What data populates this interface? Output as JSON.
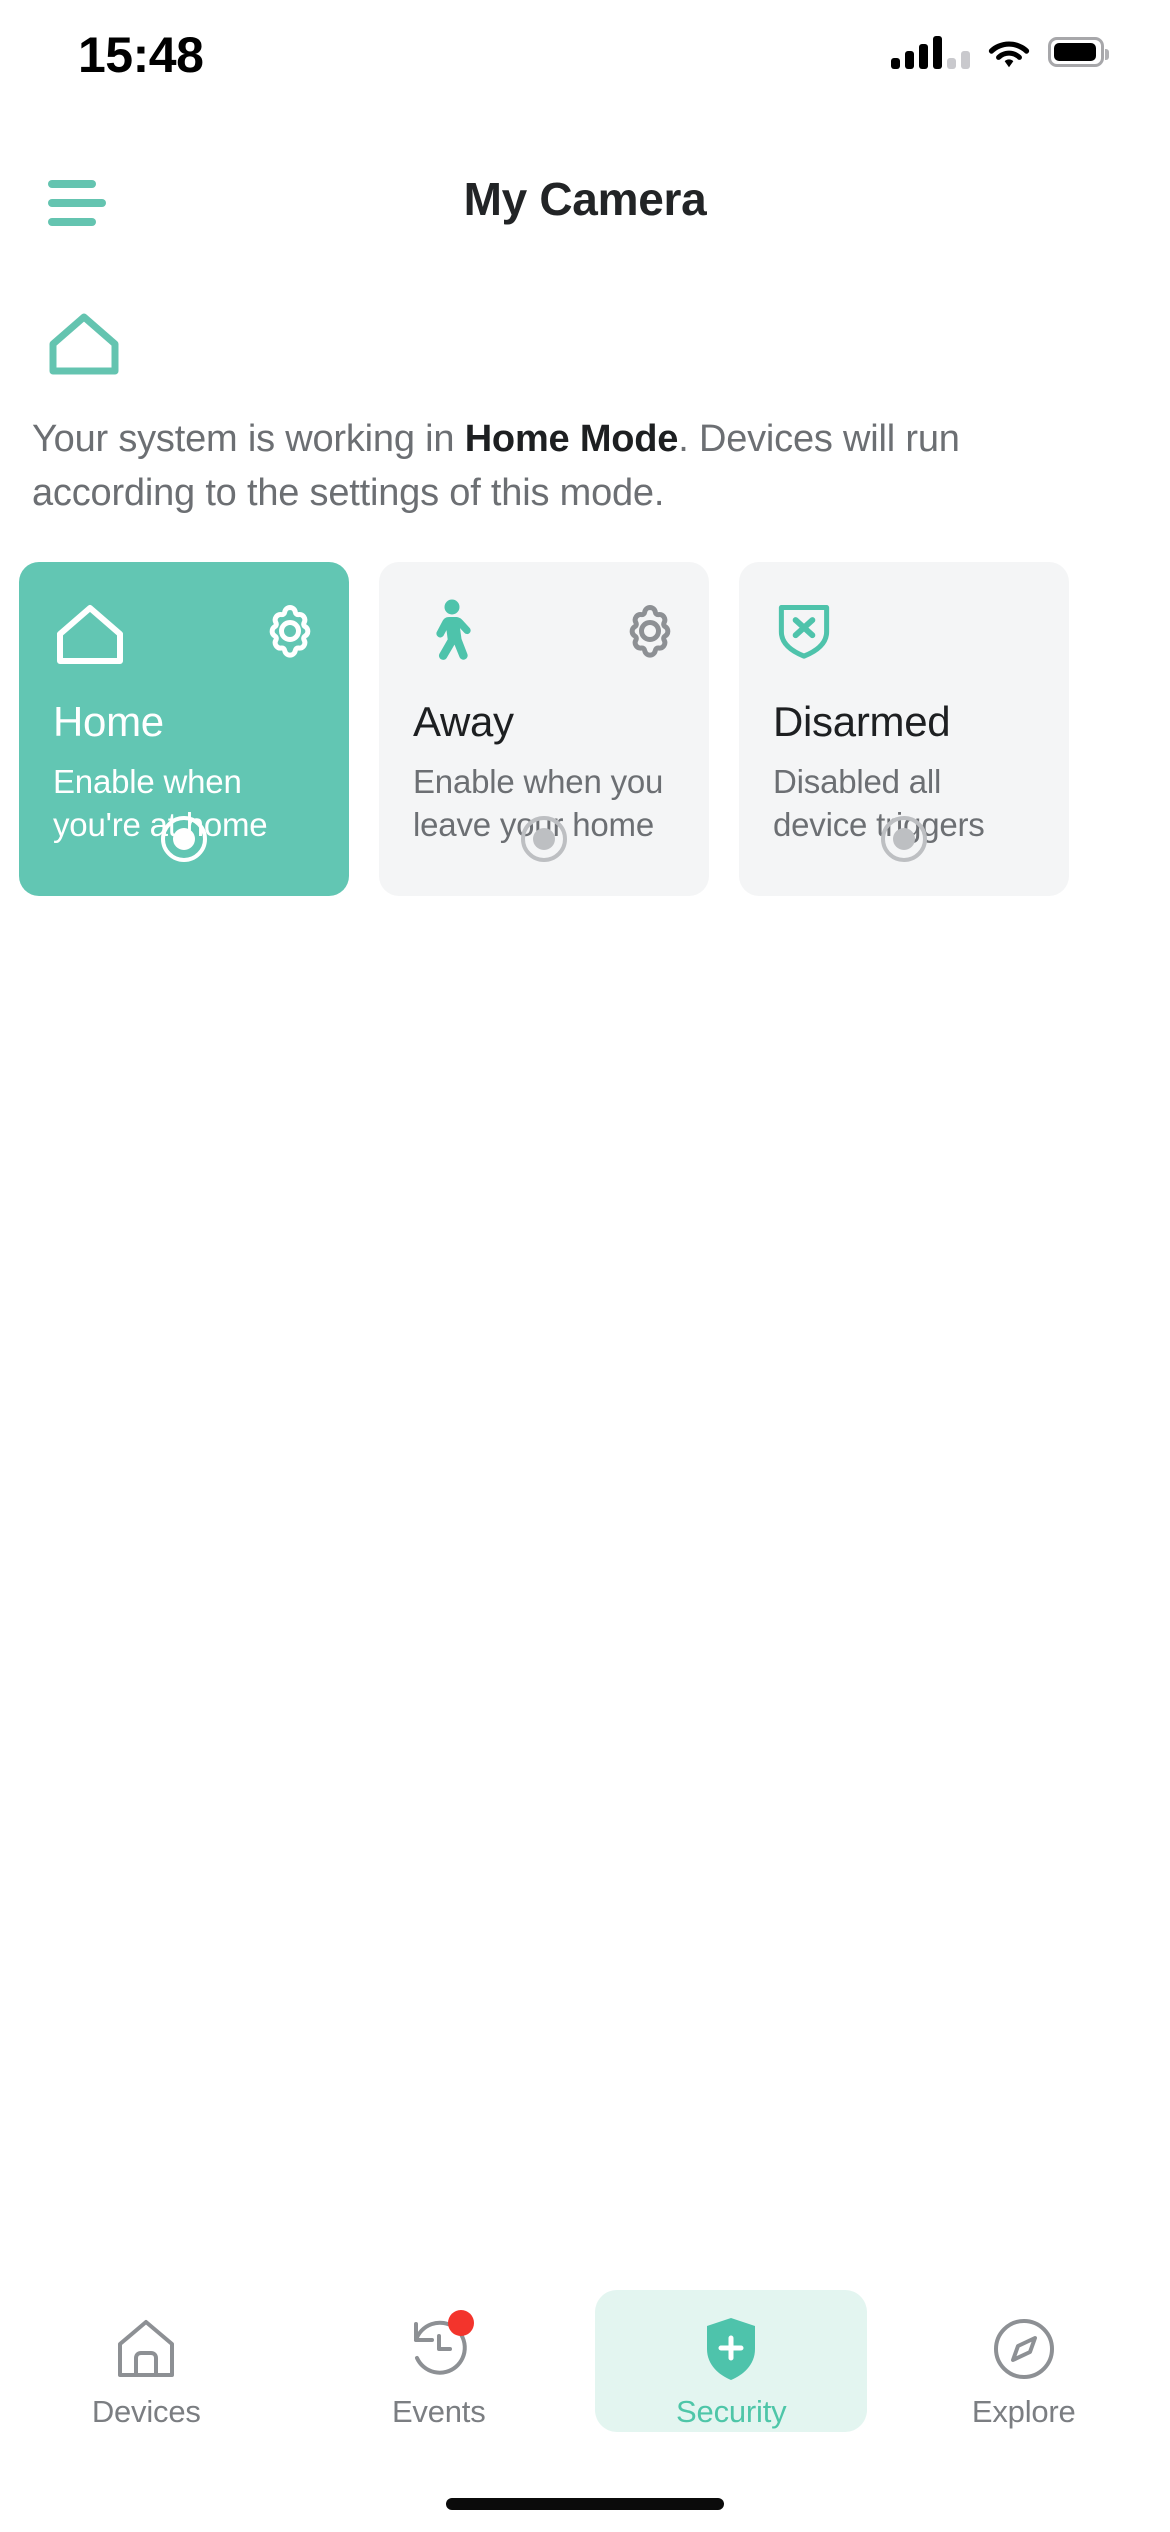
{
  "status_bar": {
    "time": "15:48",
    "signal_icon": "cellular-signal-icon",
    "wifi_icon": "wifi-icon",
    "battery_icon": "battery-icon"
  },
  "header": {
    "menu_icon": "hamburger-menu-icon",
    "title": "My Camera"
  },
  "mode_banner": {
    "icon": "home-outline-icon",
    "text_before": "Your system is working in ",
    "mode_name": "Home Mode",
    "text_after": ". Devices will run according to the settings of this mode."
  },
  "colors": {
    "accent": "#62c6b3",
    "accent_text": "#4ec6a8",
    "active_pill": "#e3f5f0",
    "card_bg": "#f4f5f6",
    "badge": "#f3342c",
    "title": "#222426",
    "muted_text": "#6c6f73"
  },
  "mode_cards": [
    {
      "id": "home",
      "icon": "home-outline-icon",
      "settings_icon": "gear-icon",
      "title": "Home",
      "subtitle": "Enable when you're at home",
      "selected": true,
      "has_settings": true
    },
    {
      "id": "away",
      "icon": "walking-person-icon",
      "settings_icon": "gear-icon",
      "title": "Away",
      "subtitle": "Enable when you leave your home",
      "selected": false,
      "has_settings": true
    },
    {
      "id": "disarmed",
      "icon": "shield-x-icon",
      "settings_icon": null,
      "title": "Disarmed",
      "subtitle": "Disabled all device triggers",
      "selected": false,
      "has_settings": false
    }
  ],
  "tab_bar": {
    "tabs": [
      {
        "id": "devices",
        "label": "Devices",
        "icon": "house-outline-icon",
        "active": false,
        "badge": false
      },
      {
        "id": "events",
        "label": "Events",
        "icon": "history-clock-icon",
        "active": false,
        "badge": true
      },
      {
        "id": "security",
        "label": "Security",
        "icon": "shield-plus-icon",
        "active": true,
        "badge": false
      },
      {
        "id": "explore",
        "label": "Explore",
        "icon": "compass-icon",
        "active": false,
        "badge": false
      }
    ]
  }
}
